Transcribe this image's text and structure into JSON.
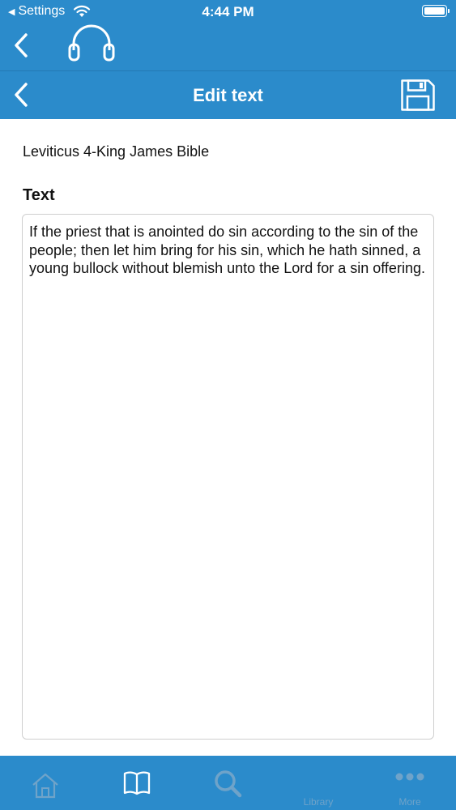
{
  "status": {
    "back_label": "Settings",
    "time": "4:44 PM"
  },
  "nav": {
    "title": "Edit text"
  },
  "content": {
    "book_title": "Leviticus 4-King James Bible",
    "section_label": "Text",
    "text_value": "If the priest that is anointed do sin according to the sin of the people; then let him bring for his sin, which he hath sinned, a young bullock without blemish unto the Lord for a sin offering."
  },
  "tabs": [
    {
      "icon": "home-icon",
      "label": ""
    },
    {
      "icon": "book-icon",
      "label": ""
    },
    {
      "icon": "search-icon",
      "label": ""
    },
    {
      "icon": "library-icon",
      "label": "Library"
    },
    {
      "icon": "more-icon",
      "label": "More"
    }
  ],
  "colors": {
    "bar_blue": "#2b8bcb",
    "inactive_icon": "#6fa3c9",
    "active_icon": "#ffffff"
  }
}
